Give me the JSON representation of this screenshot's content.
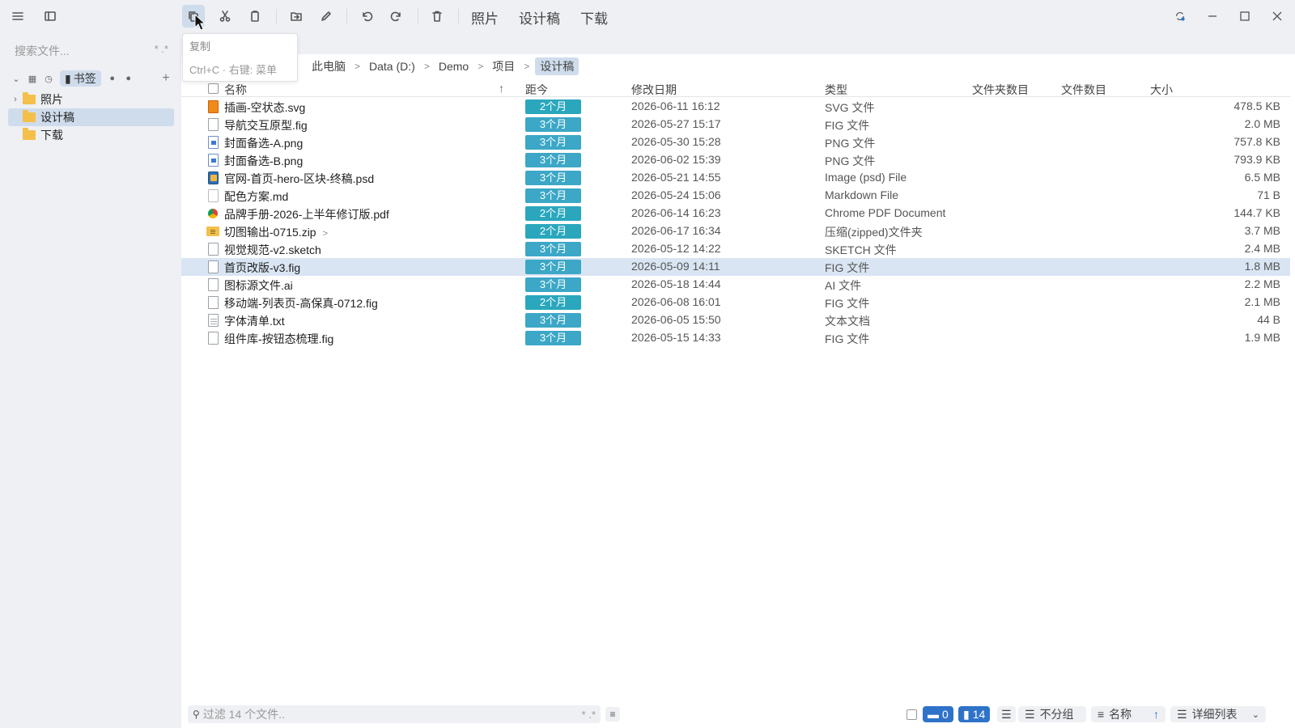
{
  "toolbar": {
    "quick_tabs": [
      "照片",
      "设计稿",
      "下载"
    ]
  },
  "tooltip": {
    "title": "复制",
    "hint": "Ctrl+C · 右键: 菜单"
  },
  "sidebar": {
    "search_placeholder": "搜索文件...",
    "search_tags": "* .*",
    "bookmark_label": "书签",
    "add_label": "+",
    "tree": [
      {
        "label": "照片",
        "expandable": true,
        "selected": false
      },
      {
        "label": "设计稿",
        "expandable": false,
        "selected": true
      },
      {
        "label": "下载",
        "expandable": false,
        "selected": false
      }
    ]
  },
  "breadcrumb": [
    "此电脑",
    "Data (D:)",
    "Demo",
    "项目",
    "设计稿"
  ],
  "table": {
    "headers": {
      "name": "名称",
      "age": "距今",
      "modified": "修改日期",
      "type": "类型",
      "folder_count": "文件夹数目",
      "file_count": "文件数目",
      "size": "大小"
    },
    "rows": [
      {
        "name": "插画-空状态.svg",
        "icon": "svg-file-icon",
        "age": "2个月",
        "date": "2026-06-11 16:12",
        "type": "SVG 文件",
        "size": "478.5 KB"
      },
      {
        "name": "导航交互原型.fig",
        "icon": "file-icon",
        "age": "3个月",
        "date": "2026-05-27 15:17",
        "type": "FIG 文件",
        "size": "2.0 MB"
      },
      {
        "name": "封面备选-A.png",
        "icon": "image-file-icon",
        "age": "3个月",
        "date": "2026-05-30 15:28",
        "type": "PNG 文件",
        "size": "757.8 KB"
      },
      {
        "name": "封面备选-B.png",
        "icon": "image-file-icon",
        "age": "3个月",
        "date": "2026-06-02 15:39",
        "type": "PNG 文件",
        "size": "793.9 KB"
      },
      {
        "name": "官网-首页-hero-区块-终稿.psd",
        "icon": "psd-file-icon",
        "age": "3个月",
        "date": "2026-05-21 14:55",
        "type": "Image (psd) File",
        "size": "6.5 MB"
      },
      {
        "name": "配色方案.md",
        "icon": "markdown-file-icon",
        "age": "3个月",
        "date": "2026-05-24 15:06",
        "type": "Markdown File",
        "size": "71 B"
      },
      {
        "name": "品牌手册-2026-上半年修订版.pdf",
        "icon": "pdf-file-icon",
        "age": "2个月",
        "date": "2026-06-14 16:23",
        "type": "Chrome PDF Document",
        "size": "144.7 KB"
      },
      {
        "name": "切图输出-0715.zip",
        "icon": "zip-folder-icon",
        "age": "2个月",
        "date": "2026-06-17 16:34",
        "type": "压缩(zipped)文件夹",
        "size": "3.7 MB"
      },
      {
        "name": "视觉规范-v2.sketch",
        "icon": "file-icon",
        "age": "3个月",
        "date": "2026-05-12 14:22",
        "type": "SKETCH 文件",
        "size": "2.4 MB"
      },
      {
        "name": "首页改版-v3.fig",
        "icon": "file-icon",
        "age": "3个月",
        "date": "2026-05-09 14:11",
        "type": "FIG 文件",
        "size": "1.8 MB",
        "selected": true
      },
      {
        "name": "图标源文件.ai",
        "icon": "file-icon",
        "age": "3个月",
        "date": "2026-05-18 14:44",
        "type": "AI 文件",
        "size": "2.2 MB"
      },
      {
        "name": "移动端-列表页-高保真-0712.fig",
        "icon": "file-icon",
        "age": "2个月",
        "date": "2026-06-08 16:01",
        "type": "FIG 文件",
        "size": "2.1 MB"
      },
      {
        "name": "字体清单.txt",
        "icon": "text-file-icon",
        "age": "3个月",
        "date": "2026-06-05 15:50",
        "type": "文本文档",
        "size": "44 B"
      },
      {
        "name": "组件库-按钮态梳理.fig",
        "icon": "file-icon",
        "age": "3个月",
        "date": "2026-05-15 14:33",
        "type": "FIG 文件",
        "size": "1.9 MB"
      }
    ]
  },
  "statusbar": {
    "filter_placeholder": "过滤 14 个文件..",
    "filter_tags": "* .*",
    "folder_count": "0",
    "file_count": "14",
    "group_label": "不分组",
    "sort_label": "名称",
    "view_label": "详细列表"
  },
  "colors": {
    "accent": "#2f73c9",
    "age_badge": "#3ca7c6",
    "selection": "#d9e5f3"
  }
}
